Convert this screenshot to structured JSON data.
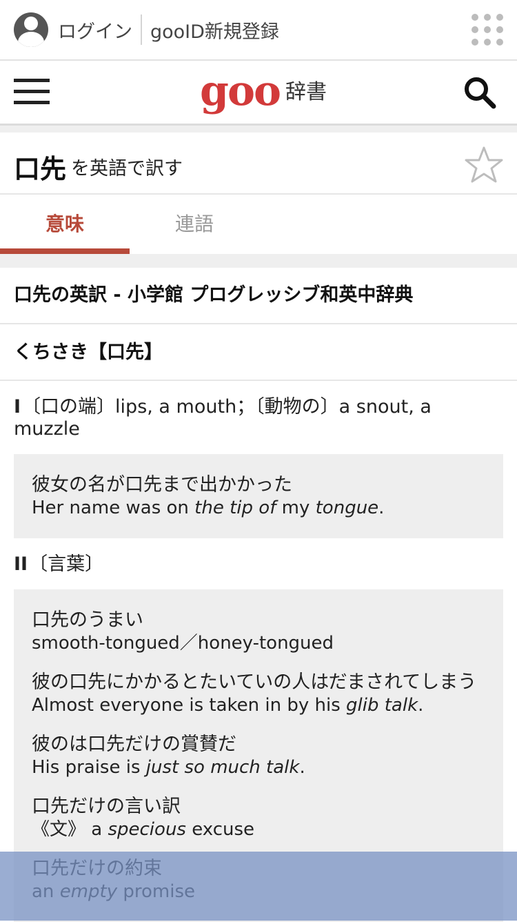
{
  "topbar": {
    "login": "ログイン",
    "register": "gooID新規登録"
  },
  "navbar": {
    "logo": "goo",
    "logo_sub": "辞書"
  },
  "title": {
    "word": "口先",
    "suffix": "を英語で訳す"
  },
  "tabs": [
    {
      "label": "意味",
      "active": true
    },
    {
      "label": "連語",
      "active": false
    }
  ],
  "section_title": "口先の英訳 - 小学館 プログレッシブ和英中辞典",
  "heading": "くちさき【口先】",
  "senses": [
    {
      "num": "I",
      "text": "〔口の端〕lips, a mouth；〔動物の〕a snout, a muzzle",
      "examples": [
        {
          "ja": "彼女の名が口先まで出かかった",
          "en": [
            {
              "t": "Her name was on ",
              "i": false
            },
            {
              "t": "the tip of",
              "i": true
            },
            {
              "t": " my ",
              "i": false
            },
            {
              "t": "tongue",
              "i": true
            },
            {
              "t": ".",
              "i": false
            }
          ]
        }
      ]
    },
    {
      "num": "II",
      "text": "〔言葉〕",
      "examples": [
        {
          "ja": "口先のうまい",
          "en": [
            {
              "t": "smooth-tongued／honey-tongued",
              "i": false
            }
          ]
        },
        {
          "ja": "彼の口先にかかるとたいていの人はだまされてしまう",
          "en": [
            {
              "t": "Almost everyone is taken in by his ",
              "i": false
            },
            {
              "t": "glib talk",
              "i": true
            },
            {
              "t": ".",
              "i": false
            }
          ]
        },
        {
          "ja": "彼のは口先だけの賞賛だ",
          "en": [
            {
              "t": "His praise is ",
              "i": false
            },
            {
              "t": "just so much talk",
              "i": true
            },
            {
              "t": ".",
              "i": false
            }
          ]
        },
        {
          "ja": "口先だけの言い訳",
          "en": [
            {
              "t": "《文》 a ",
              "i": false
            },
            {
              "t": "specious",
              "i": true
            },
            {
              "t": " excuse",
              "i": false
            }
          ]
        },
        {
          "ja": "口先だけの約束",
          "en": [
            {
              "t": "an ",
              "i": false
            },
            {
              "t": "empty",
              "i": true
            },
            {
              "t": " promise",
              "i": false
            }
          ]
        }
      ]
    }
  ],
  "colors": {
    "accent": "#b74a3a",
    "logo": "#d23a3a",
    "example_bg": "#eeeeee",
    "overlay": "#7891c3"
  }
}
